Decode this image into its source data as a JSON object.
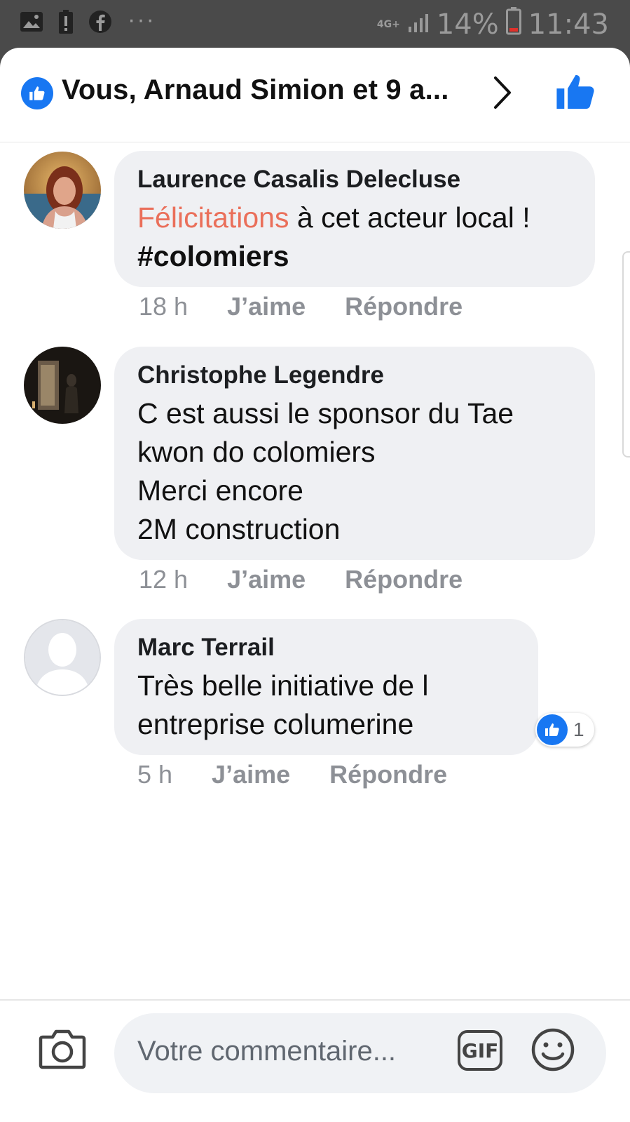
{
  "status_bar": {
    "network": "4G+",
    "battery": "14%",
    "time": "11:43",
    "icons": [
      "gallery-icon",
      "battery-alert-icon",
      "facebook-icon",
      "more-notifications-icon",
      "signal-icon",
      "battery-low-icon"
    ]
  },
  "header": {
    "reactions_summary": "Vous, Arnaud Simion et 9 a...",
    "icons": [
      "like-badge-icon",
      "chevron-right-icon",
      "thumbs-up-icon"
    ]
  },
  "comments": [
    {
      "author": "Laurence Casalis Delecluse",
      "text_mention": "Félicitations",
      "text_rest": " à cet acteur local !",
      "hashtag": "#colomiers",
      "time": "18 h",
      "like_label": "J’aime",
      "reply_label": "Répondre"
    },
    {
      "author": "Christophe Legendre",
      "text": "C est aussi le sponsor du Tae\nkwon do colomiers\nMerci encore\n2M construction",
      "time": "12 h",
      "like_label": "J’aime",
      "reply_label": "Répondre"
    },
    {
      "author": "Marc Terrail",
      "text": "Très belle initiative de l\nentreprise columerine",
      "time": "5 h",
      "like_label": "J’aime",
      "reply_label": "Répondre",
      "reaction_count": "1"
    }
  ],
  "composer": {
    "placeholder": "Votre commentaire...",
    "gif_label": "GIF",
    "icons": [
      "camera-icon",
      "gif-icon",
      "emoji-icon"
    ]
  },
  "colors": {
    "accent": "#1877f2",
    "mention": "#ea6f5a",
    "bubble": "#eff0f3",
    "status_bar": "#4a4a4a"
  }
}
